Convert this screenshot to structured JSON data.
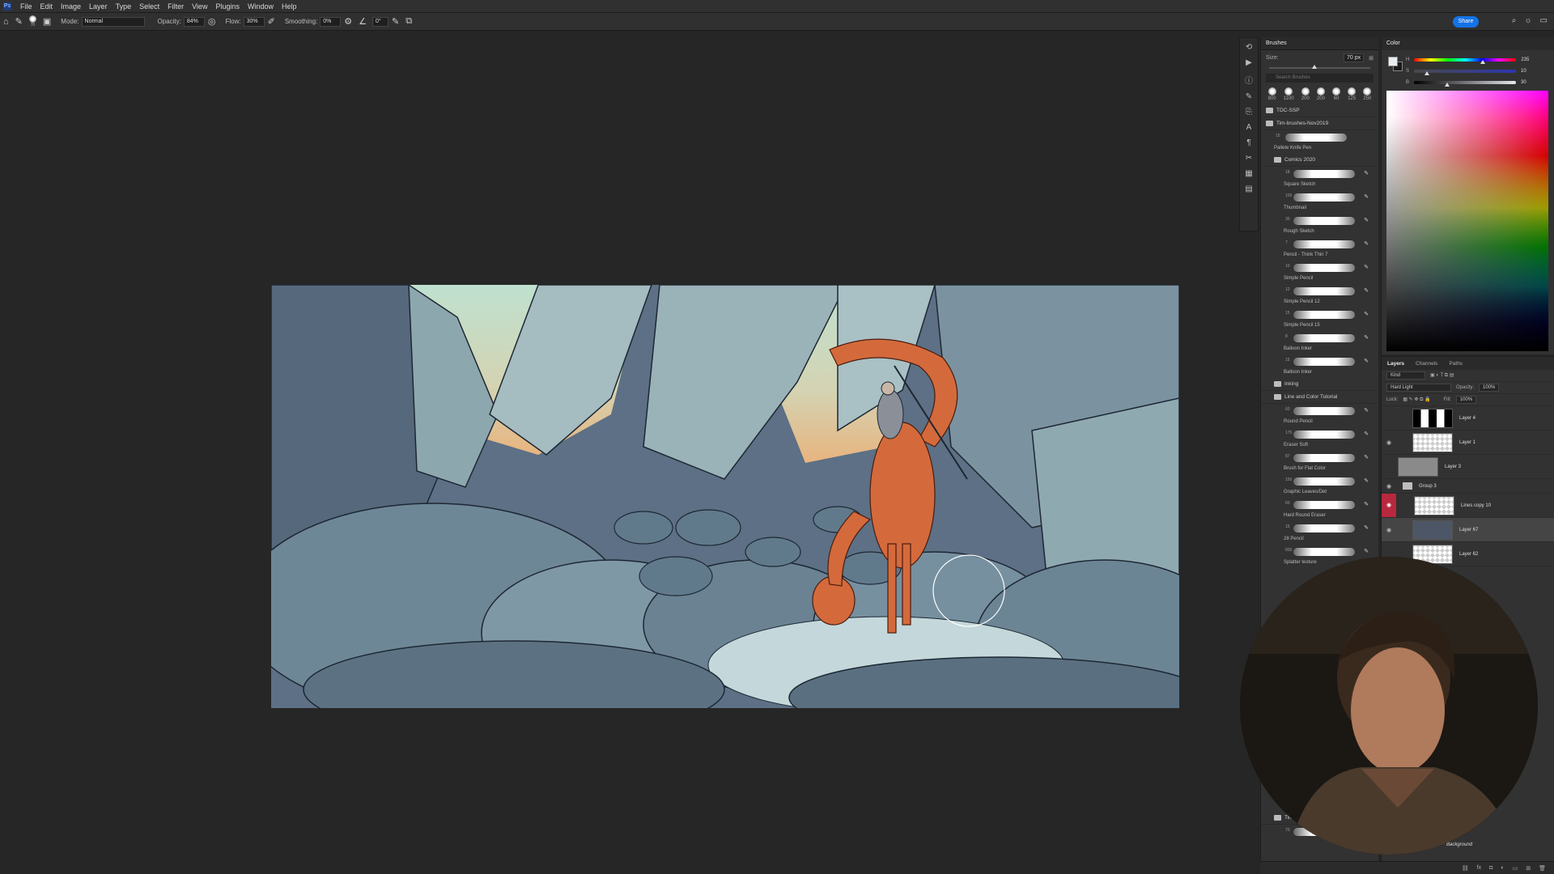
{
  "menu": {
    "app_icon": "Ps",
    "items": [
      "File",
      "Edit",
      "Image",
      "Layer",
      "Type",
      "Select",
      "Filter",
      "View",
      "Plugins",
      "Window",
      "Help"
    ]
  },
  "options": {
    "brush_size": "70",
    "mode_label": "Mode:",
    "mode_value": "Normal",
    "opacity_label": "Opacity:",
    "opacity_value": "84%",
    "flow_label": "Flow:",
    "flow_value": "30%",
    "smoothing_label": "Smoothing:",
    "smoothing_value": "0%",
    "angle_value": "0°",
    "share_label": "Share"
  },
  "brushes_panel": {
    "title": "Brushes",
    "size_label": "Size:",
    "size_value": "70 px",
    "search_placeholder": "Search Brushes",
    "size_fraction": 0.42,
    "presets": [
      "800",
      "1100",
      "200",
      "200",
      "60",
      "125",
      "250"
    ],
    "folders": {
      "tdc": "TDC-SSP",
      "tim_brushes": "Tim-brushes-Nov2019",
      "comics": "Comics 2020",
      "inking": "Inking",
      "line_color": "Line and Color Tutorial",
      "tim": "Tim"
    },
    "top_brush": {
      "num": "15",
      "label": "Pallete Knife Pen"
    },
    "comics_brushes": [
      {
        "num": "18",
        "label": "Square Sketch"
      },
      {
        "num": "100",
        "label": "Thumbnail"
      },
      {
        "num": "30",
        "label": "Rough Sketch"
      },
      {
        "num": "7",
        "label": "Pencil - Think Thin 7"
      },
      {
        "num": "10",
        "label": "Simple Pencil"
      },
      {
        "num": "12",
        "label": "Simple Pencil 12"
      },
      {
        "num": "15",
        "label": "Simple Pencil 15"
      },
      {
        "num": "8",
        "label": "Balloon Inker"
      },
      {
        "num": "15",
        "label": "Balloon Inker"
      }
    ],
    "tutorial_brushes": [
      {
        "num": "60",
        "label": "Round Pencil"
      },
      {
        "num": "175",
        "label": "Eraser Soft"
      },
      {
        "num": "87",
        "label": "Brush for Flat Color"
      },
      {
        "num": "150",
        "label": "Graphic Leaves/Det"
      },
      {
        "num": "60",
        "label": "Hard Round Eraser"
      },
      {
        "num": "15",
        "label": "28 Pencil"
      },
      {
        "num": "800",
        "label": "Splatter texture"
      }
    ],
    "tim_brush": {
      "num": "70",
      "label": ""
    }
  },
  "color_panel": {
    "title": "Color",
    "h_label": "H",
    "s_label": "S",
    "b_label": "B",
    "h_value": "235",
    "s_value": "10",
    "b_value": "30",
    "h_fraction": 0.65,
    "s_fraction": 0.1,
    "b_fraction": 0.3,
    "foreground": "#e9edf0",
    "background": "#1a1a1a"
  },
  "layers_panel": {
    "tabs": [
      "Layers",
      "Channels",
      "Paths"
    ],
    "kind_label": "Kind",
    "blend_mode": "Hard Light",
    "opacity_label": "Opacity:",
    "opacity_value": "100%",
    "lock_label": "Lock:",
    "fill_label": "Fill:",
    "fill_value": "100%",
    "layers": [
      {
        "name": "Layer 4"
      },
      {
        "name": "Layer 1"
      },
      {
        "name": "Layer 3"
      },
      {
        "name": "Group 3"
      },
      {
        "name": "Lines copy 10"
      },
      {
        "name": "Layer 67"
      },
      {
        "name": "Layer 62"
      }
    ],
    "background_layer": "Background"
  }
}
